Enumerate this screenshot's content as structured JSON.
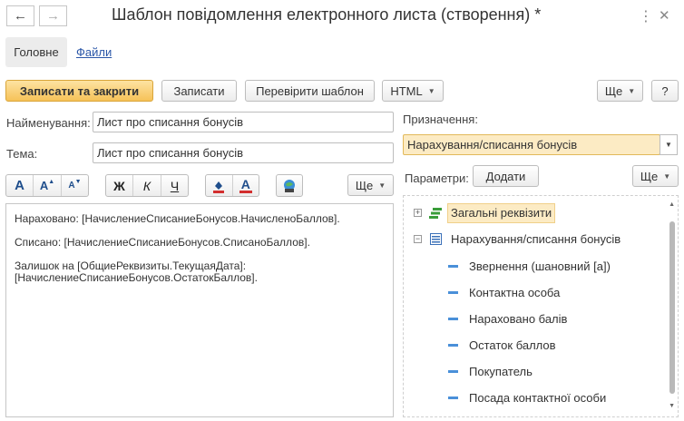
{
  "window": {
    "title": "Шаблон повідомлення електронного листа (створення) *"
  },
  "tabs": {
    "main": "Головне",
    "files": "Файли"
  },
  "toolbar": {
    "save_close": "Записати та закрити",
    "save": "Записати",
    "check": "Перевірити шаблон",
    "format": "HTML",
    "more": "Ще",
    "help": "?"
  },
  "fields": {
    "name_label": "Найменування:",
    "name_value": "Лист про списання бонусів",
    "subject_label": "Тема:",
    "subject_value": "Лист про списання бонусів",
    "purpose_label": "Призначення:",
    "purpose_value": "Нарахування/списання бонусів",
    "params_label": "Параметри:",
    "add_button": "Додати",
    "params_more": "Ще"
  },
  "format_toolbar": {
    "font": "A",
    "font_up": "A",
    "font_down": "A",
    "bold": "Ж",
    "italic": "К",
    "underline": "Ч",
    "text_color": "A",
    "more": "Ще"
  },
  "editor": {
    "lines": [
      "Нараховано: [НачислениеСписаниеБонусов.НачисленоБаллов].",
      "Списано: [НачислениеСписаниеБонусов.СписаноБаллов].",
      "Залишок на [ОбщиеРеквизиты.ТекущаяДата]:",
      "[НачислениеСписаниеБонусов.ОстатокБаллов]."
    ]
  },
  "tree": {
    "group1": "Загальні реквізити",
    "group2": "Нарахування/списання бонусів",
    "items": [
      "Звернення (шановний [а])",
      "Контактна особа",
      "Нараховано балів",
      "Остаток баллов",
      "Покупатель",
      "Посада контактної особи"
    ]
  },
  "colors": {
    "primary_button": "#f6c258",
    "selected_field": "#fcebc4",
    "link": "#2a56a8",
    "tree_item_icon": "#4a90d9"
  }
}
